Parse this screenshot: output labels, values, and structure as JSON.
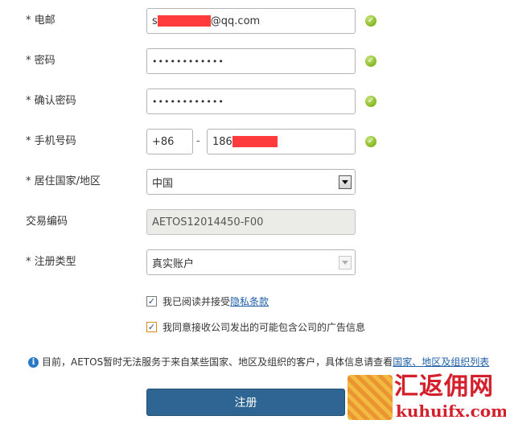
{
  "form": {
    "email": {
      "label": "* 电邮",
      "value_prefix": "s",
      "value_suffix": "@qq.com"
    },
    "password": {
      "label": "* 密码",
      "value": "••••••••••••"
    },
    "confirm_password": {
      "label": "* 确认密码",
      "value": "••••••••••••"
    },
    "phone": {
      "label": "* 手机号码",
      "country_code": "+86",
      "separator": "-",
      "value_prefix": "186"
    },
    "country": {
      "label": "* 居住国家/地区",
      "selected": "中国"
    },
    "trading_code": {
      "label": "交易编码",
      "value": "AETOS12014450-F00"
    },
    "account_type": {
      "label": "* 注册类型",
      "selected": "真实账户"
    }
  },
  "agreements": {
    "privacy": {
      "text": "我已阅读并接受",
      "link": "隐私条款",
      "checked": true
    },
    "ads": {
      "text": "我同意接收公司发出的可能包含公司的广告信息",
      "checked": true
    },
    "check_mark": "✓"
  },
  "notice": {
    "text": "目前，AETOS暂时无法服务于来自某些国家、地区及组织的客户，具体信息请查看",
    "link": "国家、地区及组织列表"
  },
  "submit_label": "注册",
  "watermark": {
    "title": "汇返佣网",
    "url": "kuhuifx.com"
  },
  "colors": {
    "valid_check": "#8fbf2b",
    "redaction": "#ff3b3b",
    "submit_bg": "#2e6592",
    "link": "#1f5fa8",
    "watermark": "#d4202c"
  }
}
